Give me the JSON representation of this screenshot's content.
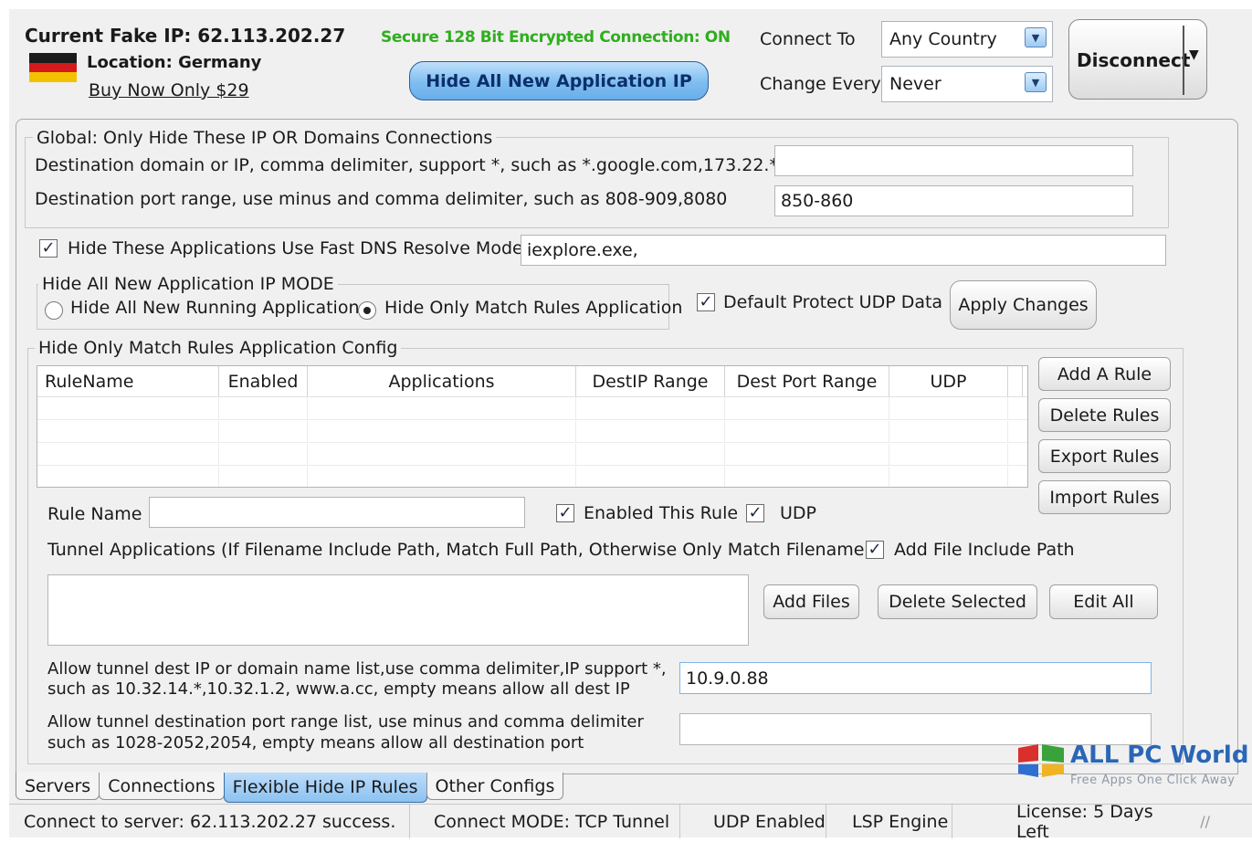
{
  "header": {
    "current_ip": "Current Fake IP: 62.113.202.27",
    "location": "Location: Germany",
    "buy_link": "Buy Now Only $29",
    "secure_status": "Secure 128 Bit Encrypted Connection: ON",
    "hide_all_button": "Hide All New Application IP",
    "connect_to_label": "Connect To",
    "connect_to_value": "Any Country",
    "change_every_label": "Change Every",
    "change_every_value": "Never",
    "disconnect_button": "Disconnect",
    "flag_colors": [
      "#1b1b1b",
      "#d41a1a",
      "#f2c200"
    ]
  },
  "global": {
    "title": "Global: Only Hide These IP OR Domains Connections",
    "dest_domain_label": "Destination domain or IP, comma delimiter, support *, such as *.google.com,173.22.*",
    "dest_domain_value": "",
    "dest_port_label": "Destination port range, use minus and comma delimiter, such as 808-909,8080",
    "dest_port_value": "850-860"
  },
  "fast_dns": {
    "checked": true,
    "label": "Hide These Applications Use Fast DNS Resolve Mode",
    "value": "iexplore.exe,"
  },
  "mode": {
    "title": "Hide All New Application IP MODE",
    "option_all": "Hide All New Running Application",
    "option_match": "Hide Only Match Rules Application",
    "selected": "match"
  },
  "udp_default": {
    "checked": true,
    "label": "Default Protect UDP Data"
  },
  "apply_button": "Apply Changes",
  "rules": {
    "title": "Hide Only Match Rules Application Config",
    "columns": [
      "RuleName",
      "Enabled",
      "Applications",
      "DestIP Range",
      "Dest Port Range",
      "UDP"
    ],
    "rows": [],
    "add_button": "Add A Rule",
    "delete_button": "Delete Rules",
    "export_button": "Export Rules",
    "import_button": "Import Rules"
  },
  "rule_editor": {
    "rule_name_label": "Rule Name",
    "rule_name_value": "",
    "enabled_label": "Enabled This Rule",
    "enabled_checked": true,
    "udp_label": "UDP",
    "udp_checked": true,
    "tunnel_apps_label": "Tunnel Applications (If Filename Include Path, Match Full Path, Otherwise Only Match Filename)",
    "add_path_label": "Add File Include Path",
    "add_path_checked": true,
    "add_files_button": "Add Files",
    "delete_selected_button": "Delete Selected",
    "edit_all_button": "Edit All",
    "dest_ip_label_1": "Allow tunnel dest IP or domain name list,use comma delimiter,IP support *,",
    "dest_ip_label_2": "such as 10.32.14.*,10.32.1.2, www.a.cc, empty means allow all dest IP",
    "dest_ip_value": "10.9.0.88",
    "dest_port_label_1": "Allow tunnel destination port range list, use minus and comma delimiter",
    "dest_port_label_2": "such as 1028-2052,2054, empty means allow all destination port",
    "dest_port_value": ""
  },
  "tabs": [
    "Servers",
    "Connections",
    "Flexible Hide IP Rules",
    "Other Configs"
  ],
  "active_tab": 2,
  "status": {
    "connect": "Connect to server: 62.113.202.27 success.",
    "mode": "Connect MODE: TCP Tunnel",
    "udp": "UDP Enabled",
    "engine": "LSP Engine",
    "license": "License: 5 Days Left"
  },
  "watermark": {
    "title": "ALL PC World",
    "subtitle": "Free Apps One Click Away",
    "colors": [
      "#d9302c",
      "#3aa23a",
      "#2f6fd0",
      "#f0b323"
    ]
  }
}
